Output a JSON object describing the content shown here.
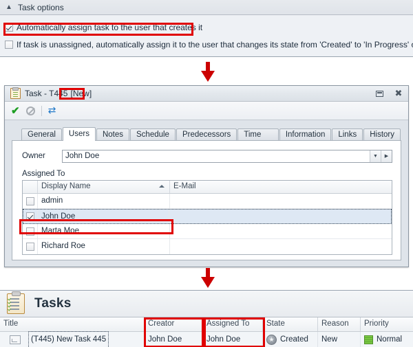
{
  "task_options": {
    "header_title": "Task options",
    "collapse_icon": "chevron-up-icon",
    "options": [
      {
        "label": "Automatically assign task to the user that creates it",
        "checked": true,
        "highlighted": true
      },
      {
        "label": "If task is unassigned, automatically assign it to the user that changes its state from  'Created' to 'In Progress' or 'Closed'",
        "checked": false,
        "highlighted": false
      }
    ]
  },
  "task_window": {
    "title_prefix": "Task - T445",
    "title_badge": "[New]",
    "window_icon": "task-clipboard-icon",
    "buttons": {
      "restore": "restore-icon",
      "close": "close-icon"
    },
    "toolbar": {
      "ok": "green-check-icon",
      "cancel": "cancel-disabled-icon",
      "refresh": "refresh-icon"
    },
    "tabs": [
      {
        "label": "General",
        "active": false
      },
      {
        "label": "Users",
        "active": true
      },
      {
        "label": "Notes",
        "active": false
      },
      {
        "label": "Schedule",
        "active": false
      },
      {
        "label": "Predecessors",
        "active": false
      },
      {
        "label": "Time log",
        "active": false
      },
      {
        "label": "Information",
        "active": false
      },
      {
        "label": "Links",
        "active": false
      },
      {
        "label": "History",
        "active": false
      }
    ],
    "owner": {
      "label": "Owner",
      "value": "John Doe",
      "dropdown_icon": "chevron-down-icon",
      "open_icon": "chevron-right-icon"
    },
    "assigned_to": {
      "section_label": "Assigned To",
      "columns": [
        "",
        "Display Name",
        "E-Mail"
      ],
      "sort_column": "Display Name",
      "sort_direction": "asc",
      "rows": [
        {
          "checked": false,
          "display_name": "admin",
          "email": "",
          "selected": false,
          "highlighted": false
        },
        {
          "checked": true,
          "display_name": "John Doe",
          "email": "",
          "selected": true,
          "highlighted": true
        },
        {
          "checked": false,
          "display_name": "Marta Moe",
          "email": "",
          "selected": false,
          "highlighted": false
        },
        {
          "checked": false,
          "display_name": "Richard Roe",
          "email": "",
          "selected": false,
          "highlighted": false
        }
      ]
    }
  },
  "tasks_list": {
    "header_icon": "tasks-clipboard-icon",
    "title": "Tasks",
    "columns": [
      {
        "label": "Title",
        "highlighted": false
      },
      {
        "label": "Creator",
        "highlighted": true
      },
      {
        "label": "Assigned To",
        "highlighted": true
      },
      {
        "label": "State",
        "highlighted": false
      },
      {
        "label": "Reason",
        "highlighted": false
      },
      {
        "label": "Priority",
        "highlighted": false
      }
    ],
    "rows": [
      {
        "title": "(T445) New Task 445",
        "creator": "John Doe",
        "assigned_to": "John Doe",
        "state": "Created",
        "state_icon": "state-created-icon",
        "reason": "New",
        "priority": "Normal",
        "priority_icon": "priority-normal-icon"
      }
    ]
  },
  "arrows": [
    {
      "name": "flow-arrow-top",
      "direction": "down"
    },
    {
      "name": "flow-arrow-bottom",
      "direction": "down"
    }
  ],
  "colors": {
    "highlight": "#e00000",
    "arrow": "#cc0000",
    "selection": "#dee8f4",
    "priority_normal": "#7ac943"
  }
}
